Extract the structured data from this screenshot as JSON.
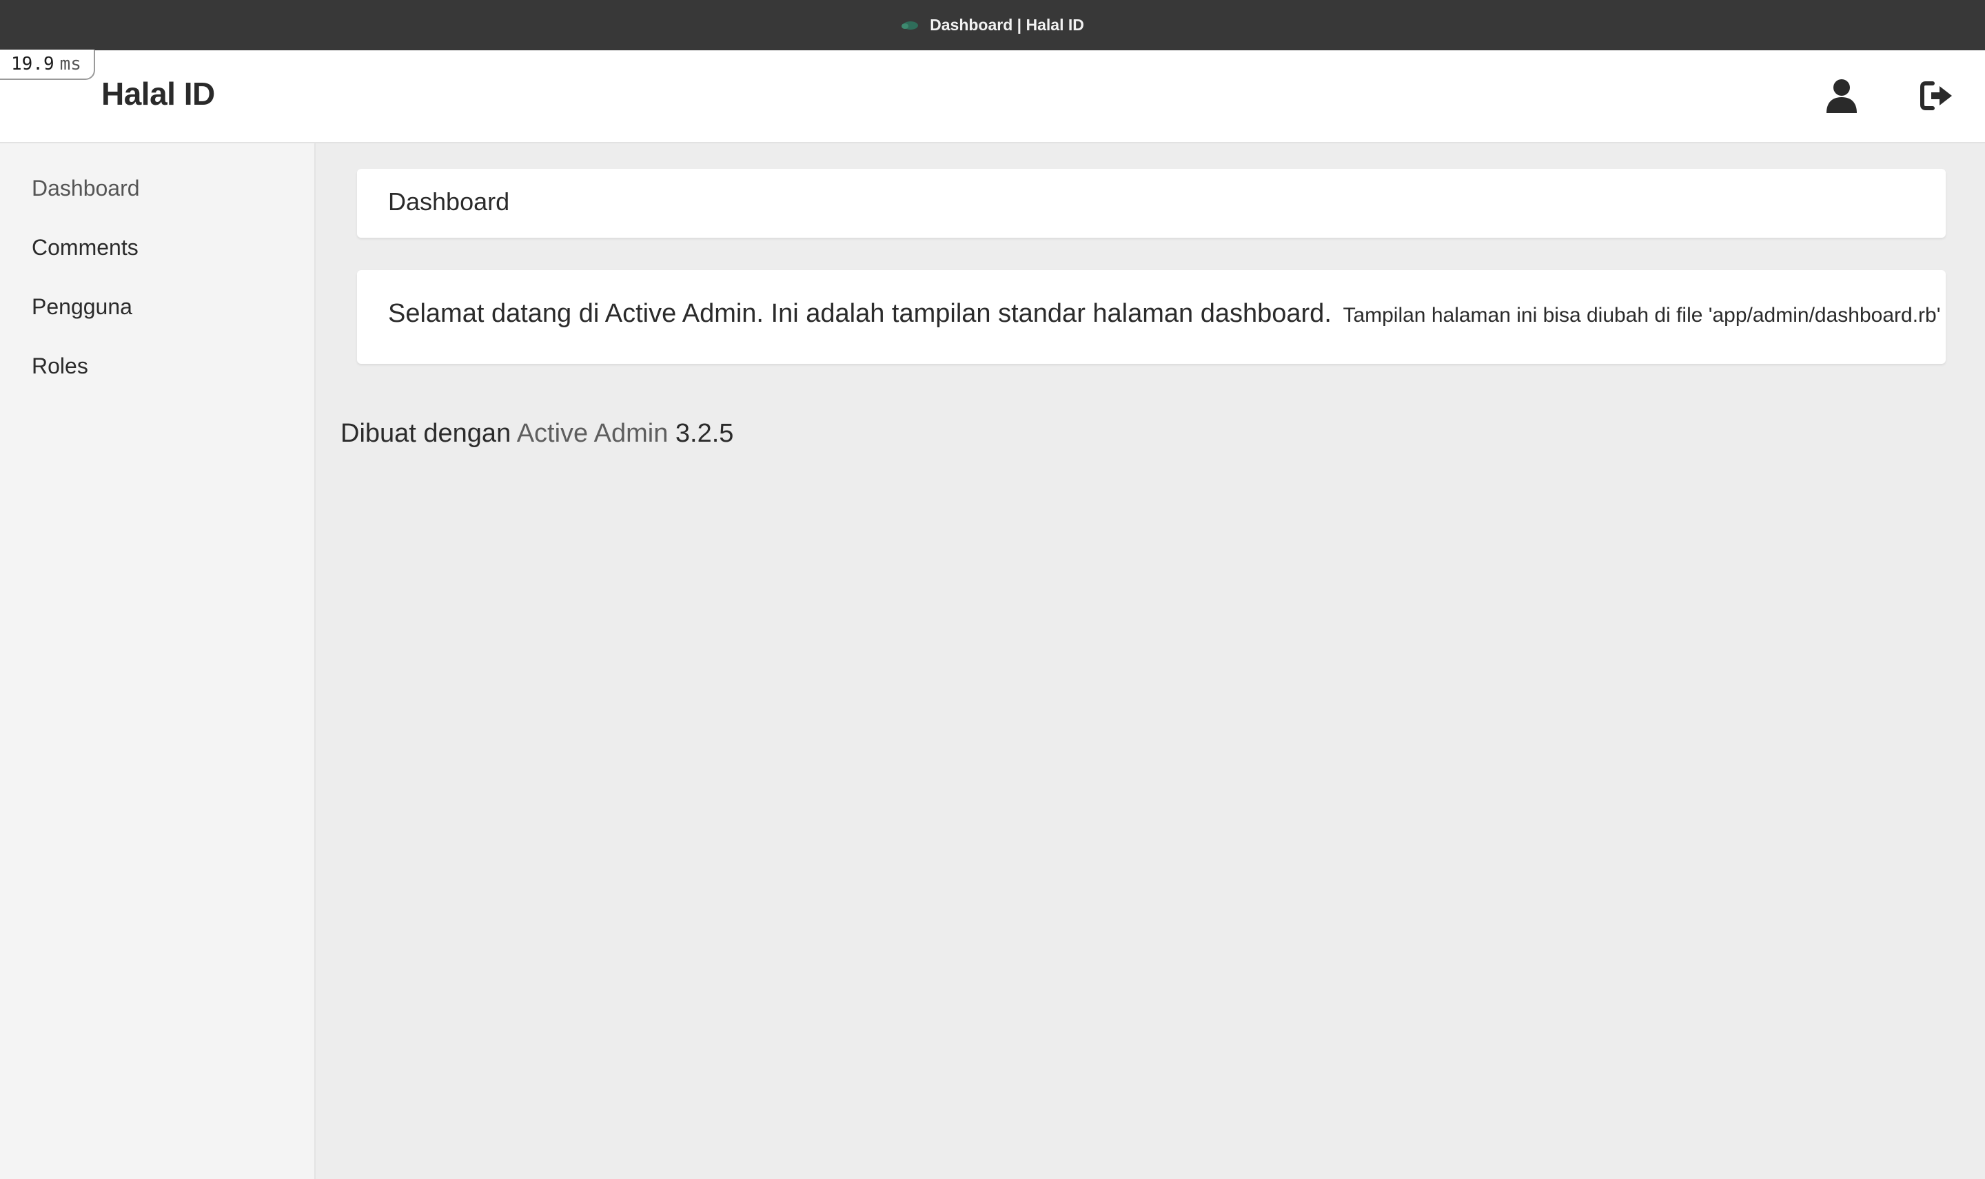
{
  "window": {
    "title": "Dashboard | Halal ID"
  },
  "timing": {
    "value": "19.9",
    "unit": "ms"
  },
  "header": {
    "brand": "Halal ID",
    "icons": {
      "user": "user-icon",
      "logout": "logout-icon"
    }
  },
  "sidebar": {
    "items": [
      {
        "label": "Dashboard",
        "active": true
      },
      {
        "label": "Comments"
      },
      {
        "label": "Pengguna"
      },
      {
        "label": "Roles"
      }
    ]
  },
  "main": {
    "page_title": "Dashboard",
    "welcome": "Selamat datang di Active Admin. Ini adalah tampilan standar halaman dashboard.",
    "hint": "Tampilan halaman ini bisa diubah di file 'app/admin/dashboard.rb'"
  },
  "footer": {
    "prefix": "Dibuat dengan",
    "link": "Active Admin",
    "version": "3.2.5"
  },
  "colors": {
    "titlebar": "#383838",
    "background": "#ededed",
    "sidebar": "#f4f4f4",
    "text": "#2b2b2b",
    "link": "#5e5e5e"
  }
}
